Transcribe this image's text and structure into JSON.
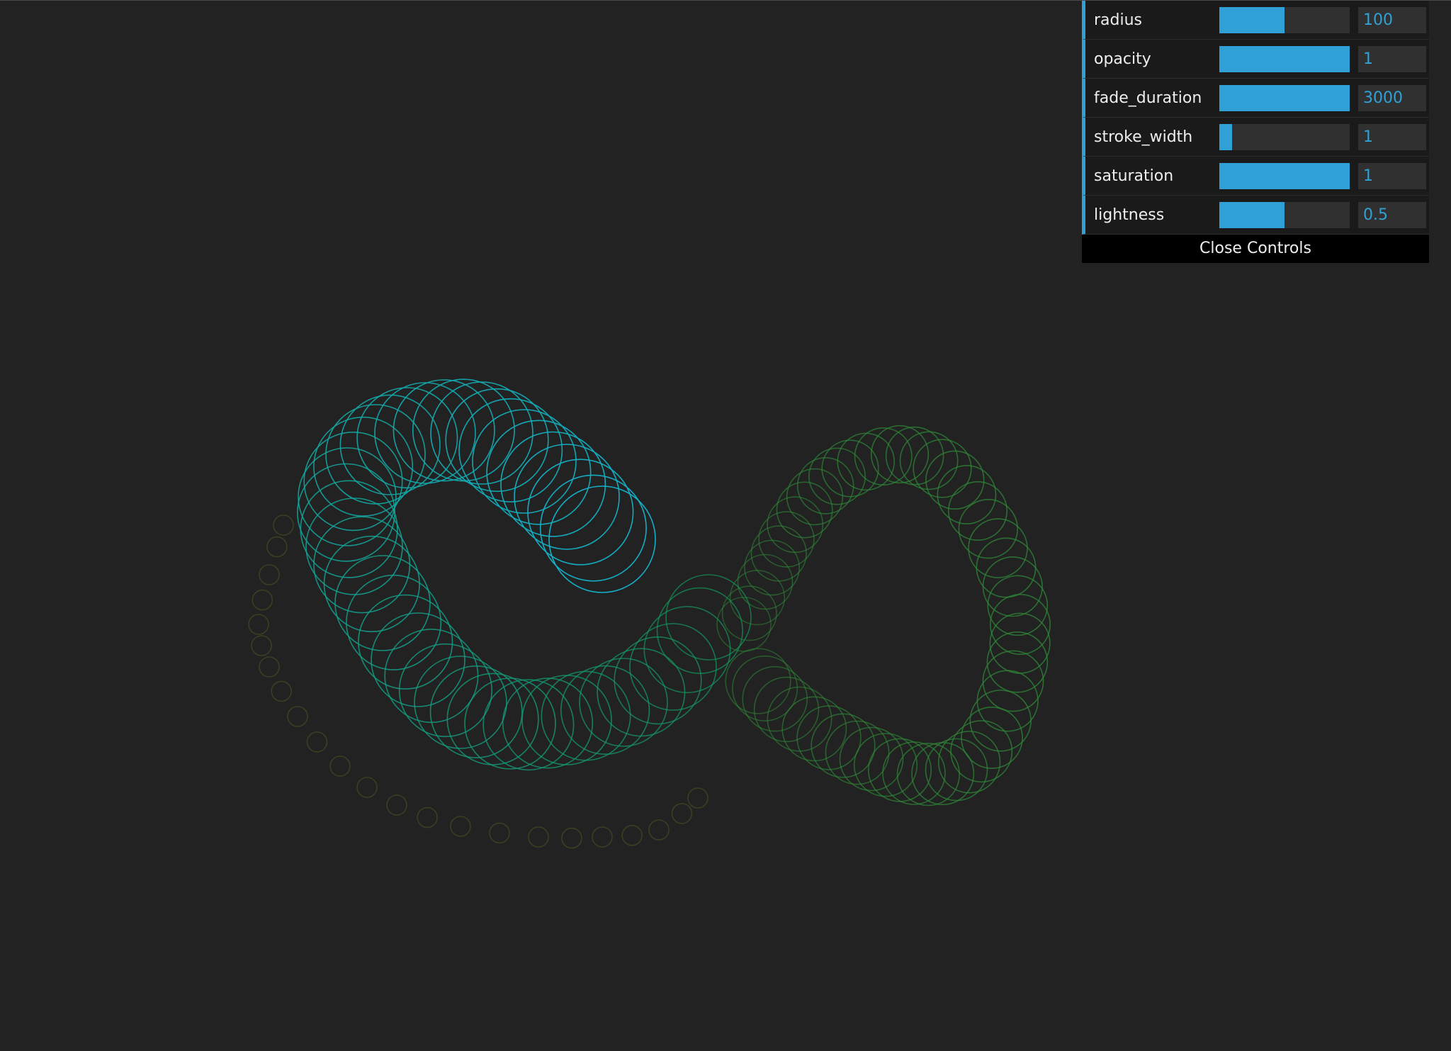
{
  "colors": {
    "background": "#222222",
    "accent": "#2fa1d6",
    "panel": "#1a1a1a",
    "field": "#303030"
  },
  "controls": {
    "rows": [
      {
        "label": "radius",
        "value": "100",
        "fill_fraction": 0.5
      },
      {
        "label": "opacity",
        "value": "1",
        "fill_fraction": 1.0
      },
      {
        "label": "fade_duration",
        "value": "3000",
        "fill_fraction": 1.0
      },
      {
        "label": "stroke_width",
        "value": "1",
        "fill_fraction": 0.1
      },
      {
        "label": "saturation",
        "value": "1",
        "fill_fraction": 1.0
      },
      {
        "label": "lightness",
        "value": "0.5",
        "fill_fraction": 0.5
      }
    ],
    "close_label": "Close Controls"
  }
}
